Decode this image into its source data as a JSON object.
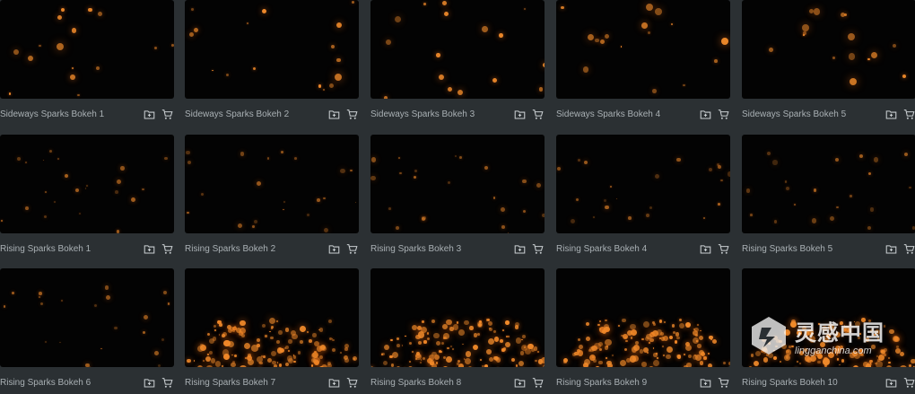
{
  "icons": {
    "folder": "folder-add-icon",
    "cart": "cart-icon"
  },
  "colors": {
    "background": "#2b3033",
    "thumb": "#030303",
    "spark": "#f08a2a",
    "text": "#a9b0b4"
  },
  "rows": [
    {
      "items": [
        {
          "title": "Sideways Sparks Bokeh 1",
          "density": "sparse"
        },
        {
          "title": "Sideways Sparks Bokeh 2",
          "density": "sparse"
        },
        {
          "title": "Sideways Sparks Bokeh 3",
          "density": "sparse"
        },
        {
          "title": "Sideways Sparks Bokeh 4",
          "density": "sparse"
        },
        {
          "title": "Sideways Sparks Bokeh 5",
          "density": "sparse"
        }
      ]
    },
    {
      "items": [
        {
          "title": "Rising Sparks Bokeh 1",
          "density": "faint"
        },
        {
          "title": "Rising Sparks Bokeh 2",
          "density": "faint"
        },
        {
          "title": "Rising Sparks Bokeh 3",
          "density": "faint"
        },
        {
          "title": "Rising Sparks Bokeh 4",
          "density": "faint"
        },
        {
          "title": "Rising Sparks Bokeh 5",
          "density": "faint"
        }
      ]
    },
    {
      "items": [
        {
          "title": "Rising Sparks Bokeh 6",
          "density": "faint"
        },
        {
          "title": "Rising Sparks Bokeh 7",
          "density": "dense"
        },
        {
          "title": "Rising Sparks Bokeh 8",
          "density": "dense"
        },
        {
          "title": "Rising Sparks Bokeh 9",
          "density": "dense"
        },
        {
          "title": "Rising Sparks Bokeh 10",
          "density": "dense"
        }
      ]
    }
  ],
  "watermark": {
    "cn_text": "灵感中国",
    "en_text": "lingganchina.com"
  }
}
